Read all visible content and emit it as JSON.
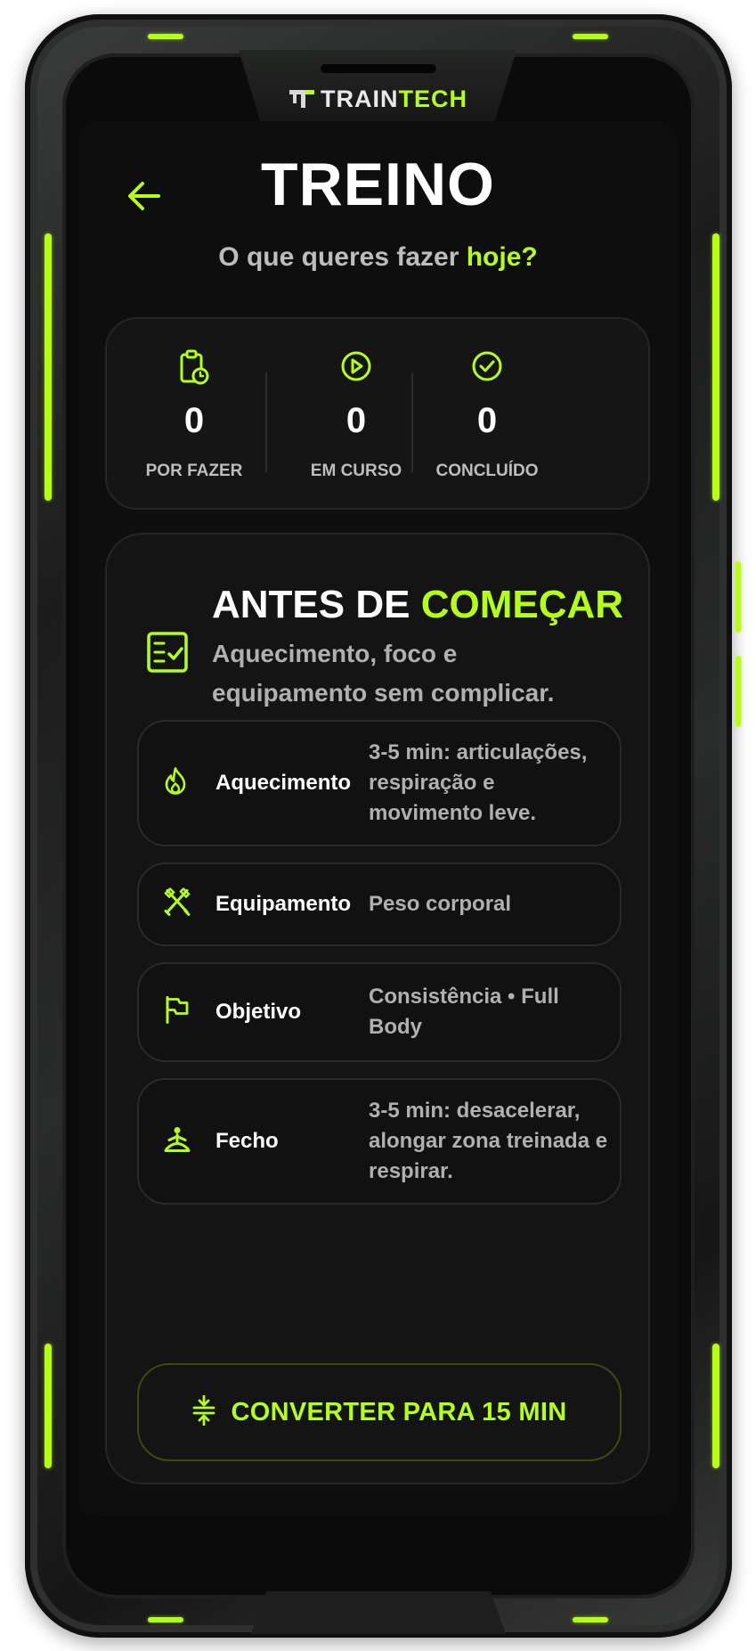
{
  "brand": {
    "prefix": "TRAIN",
    "accent": "TECH"
  },
  "header": {
    "title": "TREINO",
    "subtitle_prefix": "O que queres fazer",
    "subtitle_highlight": "hoje?"
  },
  "stats": [
    {
      "icon": "clipboard-clock-icon",
      "value": "0",
      "label": "POR FAZER"
    },
    {
      "icon": "play-circle-icon",
      "value": "0",
      "label": "EM CURSO"
    },
    {
      "icon": "check-circle-icon",
      "value": "0",
      "label": "CONCLUÍDO"
    }
  ],
  "card": {
    "title_prefix": "ANTES DE",
    "title_highlight": "COMEÇAR",
    "description": "Aquecimento, foco e equipamento sem complicar.",
    "items": [
      {
        "icon": "flame-icon",
        "label": "Aquecimento",
        "value": "3-5 min: articulações, respiração e movimento leve."
      },
      {
        "icon": "tools-icon",
        "label": "Equipamento",
        "value": "Peso corporal"
      },
      {
        "icon": "flag-icon",
        "label": "Objetivo",
        "value": "Consistência • Full Body"
      },
      {
        "icon": "meditation-icon",
        "label": "Fecho",
        "value": "3-5 min: desacelerar, alongar zona treinada e respirar."
      }
    ],
    "button_label": "CONVERTER PARA 15 MIN",
    "button_icon": "compress-icon"
  },
  "colors": {
    "accent": "#b5ff14",
    "background": "#0e0e0e",
    "card": "#141414",
    "muted_text": "#b0b0b0"
  }
}
